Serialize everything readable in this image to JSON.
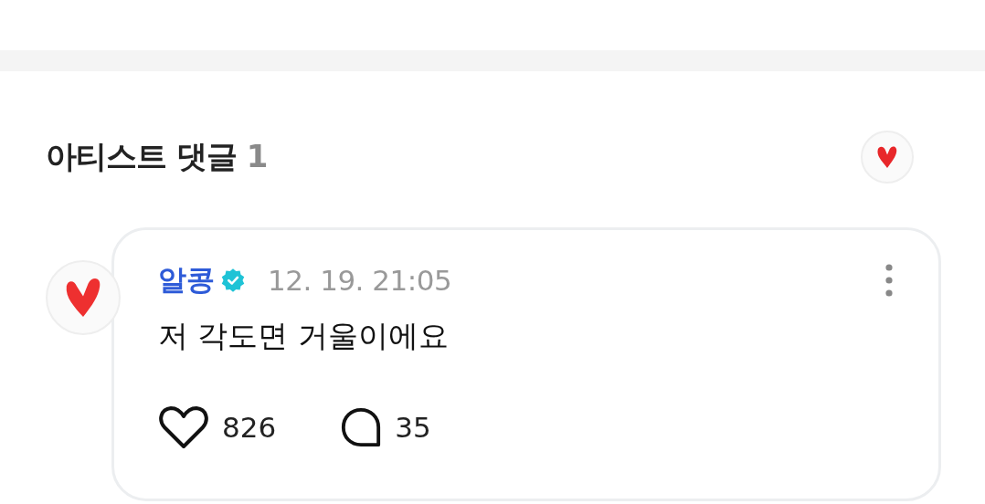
{
  "section": {
    "title": "아티스트 댓글",
    "count": "1"
  },
  "comments": [
    {
      "author": "알콩",
      "verified": true,
      "time": "12. 19. 21:05",
      "text": "저 각도면 거울이에요",
      "likes": "826",
      "replies": "35"
    }
  ]
}
